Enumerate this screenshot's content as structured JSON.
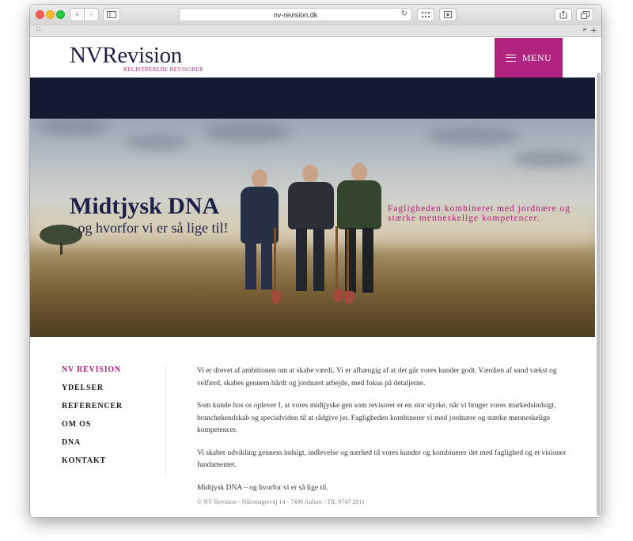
{
  "browser": {
    "url": "nv-revision.dk",
    "icons": {
      "back": "chevron-left-icon",
      "forward": "chevron-right-icon",
      "sidebar": "sidebar-icon",
      "reload": "reload-icon",
      "share": "share-icon",
      "tabs": "tabs-icon"
    }
  },
  "header": {
    "logo_title": "NVRevision",
    "logo_subtitle": "REGISTREREDE REVISORER",
    "menu_label": "MENU"
  },
  "hero": {
    "title": "Midtjysk DNA",
    "subtitle": "- og hvorfor vi er så lige til!",
    "tagline": "Fagligheden kombineret med jordnære og stærke menneskelige kompetencer."
  },
  "nav": {
    "items": [
      {
        "label": "NV REVISION",
        "active": true
      },
      {
        "label": "YDELSER",
        "active": false
      },
      {
        "label": "REFERENCER",
        "active": false
      },
      {
        "label": "OM OS",
        "active": false
      },
      {
        "label": "DNA",
        "active": false
      },
      {
        "label": "KONTAKT",
        "active": false
      }
    ]
  },
  "content": {
    "paragraphs": [
      "Vi er drevet af ambitionen om at skabe værdi. Vi er afhængig af at det går vores kunder godt. Værdien af sund vækst og velfærd, skabes gennem hårdt og jordnært arbejde, med fokus på detaljerne.",
      "Som kunde hos os oplever I, at vores midtjyske gen som revisorer er en stor styrke, når vi bruger vores markedsindsigt, branchekendskab og specialviden til at rådgive jer. Fagligheden kombinerer vi med jordnære og stærke menneskelige kompetencer.",
      "Vi skaber udvikling gennem indsigt, indlevelse og nærhed til vores kunder og kombinerer det med faglighed og et visioner fundamentet.",
      "Midtjysk DNA – og hvorfor vi er så lige til."
    ]
  },
  "footer": {
    "text": "© NV Revision - Nålemagervej 14 - 7490 Aulum - Tlf. 9747 2811"
  },
  "colors": {
    "brand_navy": "#1b2146",
    "brand_magenta": "#b01f7d",
    "band_navy": "#151a33"
  }
}
